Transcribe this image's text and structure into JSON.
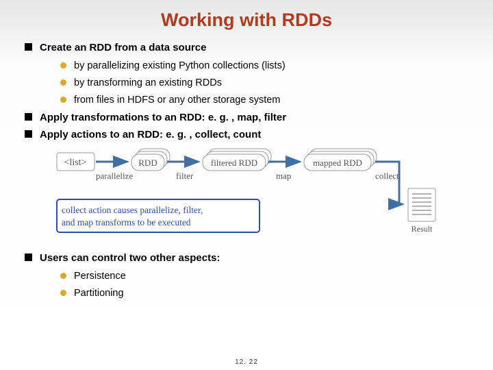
{
  "title": "Working with RDDs",
  "bullets": {
    "b1": "Create an RDD from a data source",
    "b1_subs": {
      "s1": "by parallelizing existing Python collections (lists)",
      "s2": "by transforming an existing RDDs",
      "s3": "from files in HDFS or any other storage system"
    },
    "b2": "Apply transformations to an RDD: e. g. , map, filter",
    "b3": "Apply actions to an RDD: e. g. , collect, count",
    "b4": "Users can control two other aspects:",
    "b4_subs": {
      "s1": "Persistence",
      "s2": "Partitioning"
    }
  },
  "diagram": {
    "node_list": "<list>",
    "node_rdd": "RDD",
    "node_filtered": "filtered RDD",
    "node_mapped": "mapped RDD",
    "node_result": "Result",
    "edge_parallelize": "parallelize",
    "edge_filter": "filter",
    "edge_map": "map",
    "edge_collect": "collect",
    "caption_l1": "collect action causes parallelize, filter,",
    "caption_l2": "and map transforms to be executed"
  },
  "page_number": "12. 22"
}
